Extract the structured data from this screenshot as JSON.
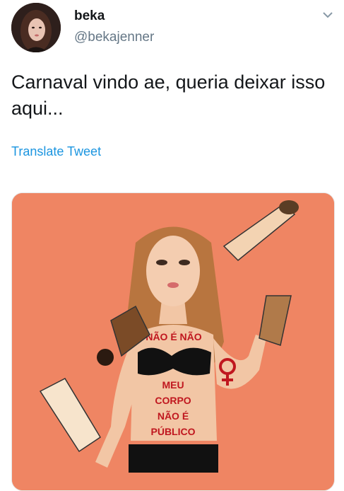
{
  "author": {
    "name": "beka",
    "handle": "@bekajenner",
    "avatar_icon": "profile-photo"
  },
  "menu_icon": "chevron-down-icon",
  "tweet": {
    "text": "Carnaval vindo ae, queria deixar isso aqui...",
    "translate_label": "Translate Tweet"
  },
  "image": {
    "background_color": "#ef8563",
    "chest_text": "NÃO É NÃO",
    "belly_lines": [
      "MEU",
      "CORPO",
      "NÃO É",
      "PÚBLICO"
    ],
    "symbol": "female-symbol"
  },
  "colors": {
    "link": "#1b95e0",
    "secondary_text": "#657786",
    "body_paint": "#c0171f"
  }
}
